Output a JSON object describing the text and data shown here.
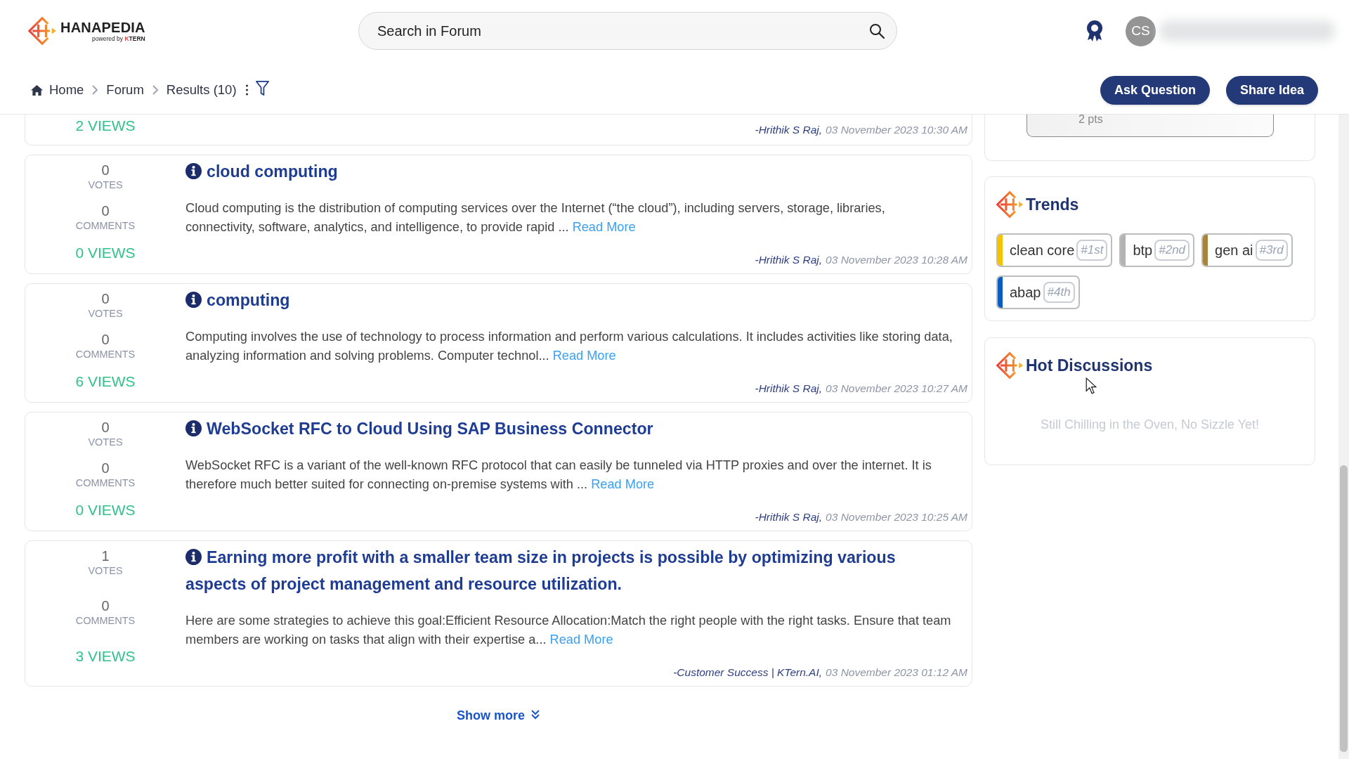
{
  "header": {
    "logo": {
      "name": "HANAPEDIA",
      "tagline": "powered by **KTERN**"
    },
    "search": {
      "placeholder": "Search in Forum"
    },
    "avatar": {
      "initials": "CS"
    }
  },
  "breadcrumb": [
    {
      "label": "Home",
      "kind": "home"
    },
    {
      "label": "Forum",
      "kind": "page"
    },
    {
      "label": "Results (10)",
      "kind": "page"
    }
  ],
  "actions": [
    {
      "label": "Ask Question"
    },
    {
      "label": "Share Idea"
    }
  ],
  "posts": [
    {
      "kind": "partial",
      "views": "2 VIEWS",
      "author": "-Hrithik S Raj,",
      "date": "03 November 2023 10:30 AM"
    },
    {
      "kind": "full",
      "votes": "0",
      "votes_label": "VOTES",
      "comments": "0",
      "comments_label": "COMMENTS",
      "views": "0 VIEWS",
      "title": "cloud computing",
      "excerpt": "Cloud computing is the distribution of computing services over the Internet (“the cloud”), including servers, storage, libraries, connectivity, software, analytics, and intelligence, to provide rapid ...",
      "link": "Read More",
      "author": "-Hrithik S Raj,",
      "date": "03 November 2023 10:28 AM"
    },
    {
      "kind": "full",
      "votes": "0",
      "votes_label": "VOTES",
      "comments": "0",
      "comments_label": "COMMENTS",
      "views": "6 VIEWS",
      "title": "computing",
      "excerpt": "Computing involves the use of technology to process information and perform various calculations. It includes activities like storing data, analyzing information and solving problems. Computer technol...",
      "link": "Read More",
      "author": "-Hrithik S Raj,",
      "date": "03 November 2023 10:27 AM"
    },
    {
      "kind": "full",
      "votes": "0",
      "votes_label": "VOTES",
      "comments": "0",
      "comments_label": "COMMENTS",
      "views": "0 VIEWS",
      "title": "WebSocket RFC to Cloud Using SAP Business Connector",
      "excerpt": "WebSocket RFC is a variant of the well-known RFC protocol that can easily be tunneled via HTTP proxies and over the internet. It is therefore much better suited for connecting on-premise systems with ...",
      "link": "Read More",
      "author": "-Hrithik S Raj,",
      "date": "03 November 2023 10:25 AM"
    },
    {
      "kind": "full",
      "votes": "1",
      "votes_label": "VOTES",
      "comments": "0",
      "comments_label": "COMMENTS",
      "views": "3 VIEWS",
      "title": "Earning more profit with a smaller team size in projects is possible by optimizing various aspects of project management and resource utilization.",
      "excerpt": "Here are some strategies to achieve this goal:Efficient Resource Allocation:Match the right people with the right tasks. Ensure that team members are working on tasks that align with their expertise a...",
      "link": "Read More",
      "author": "-Customer Success | KTern.AI,",
      "date": "03 November 2023 01:12 AM"
    }
  ],
  "show_more": {
    "label": "Show more"
  },
  "sidebar": {
    "points_card": {
      "points": "2 pts"
    },
    "trends": {
      "title": "Trends",
      "tags": [
        {
          "label": "clean core",
          "rank": "#1st",
          "color": "#f5c400"
        },
        {
          "label": "btp",
          "rank": "#2nd",
          "color": "#b3b3b3"
        },
        {
          "label": "gen ai",
          "rank": "#3rd",
          "color": "#a8843a"
        },
        {
          "label": "abap",
          "rank": "#4th",
          "color": "#0b5cc2"
        }
      ]
    },
    "hot_discussions": {
      "title": "Hot Discussions",
      "empty_message": "Still Chilling in the Oven, No Sizzle Yet!"
    }
  }
}
